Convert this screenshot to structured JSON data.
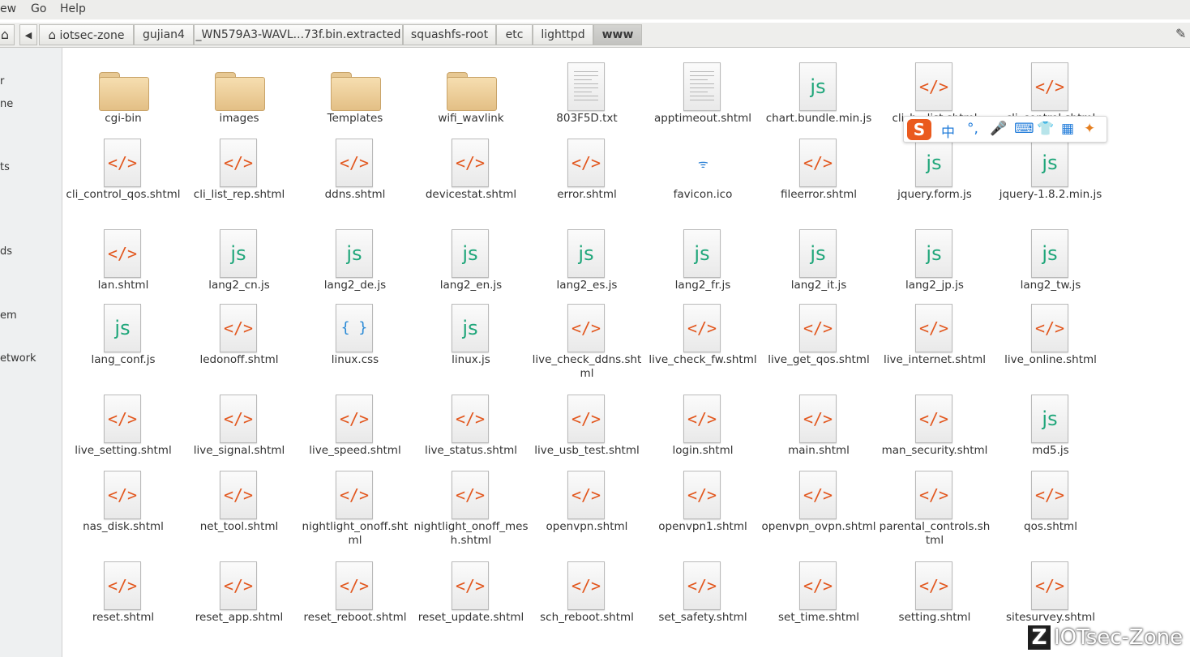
{
  "menu": {
    "view": "ew",
    "go": "Go",
    "help": "Help"
  },
  "path": {
    "crumbs": [
      "iotsec-zone",
      "gujian4",
      "_WN579A3-WAVL...73f.bin.extracted",
      "squashfs-root",
      "etc",
      "lighttpd",
      "www"
    ]
  },
  "sidebar": {
    "items": [
      "r",
      "ne",
      "ts",
      "ds",
      "em",
      "etwork"
    ]
  },
  "files": [
    {
      "name": "cgi-bin",
      "type": "folder"
    },
    {
      "name": "images",
      "type": "folder"
    },
    {
      "name": "Templates",
      "type": "folder"
    },
    {
      "name": "wifi_wavlink",
      "type": "folder"
    },
    {
      "name": "803F5D.txt",
      "type": "text"
    },
    {
      "name": "apptimeout.shtml",
      "type": "text"
    },
    {
      "name": "chart.bundle.min.js",
      "type": "js"
    },
    {
      "name": "cli_b...list.shtml",
      "type": "html"
    },
    {
      "name": "cli_control.shtml",
      "type": "html"
    },
    {
      "name": "cli_control_qos.shtml",
      "type": "html"
    },
    {
      "name": "cli_list_rep.shtml",
      "type": "html"
    },
    {
      "name": "ddns.shtml",
      "type": "html"
    },
    {
      "name": "devicestat.shtml",
      "type": "html"
    },
    {
      "name": "error.shtml",
      "type": "html"
    },
    {
      "name": "favicon.ico",
      "type": "ico"
    },
    {
      "name": "fileerror.shtml",
      "type": "html"
    },
    {
      "name": "jquery.form.js",
      "type": "js"
    },
    {
      "name": "jquery-1.8.2.min.js",
      "type": "js"
    },
    {
      "name": "lan.shtml",
      "type": "html"
    },
    {
      "name": "lang2_cn.js",
      "type": "js"
    },
    {
      "name": "lang2_de.js",
      "type": "js"
    },
    {
      "name": "lang2_en.js",
      "type": "js"
    },
    {
      "name": "lang2_es.js",
      "type": "js"
    },
    {
      "name": "lang2_fr.js",
      "type": "js"
    },
    {
      "name": "lang2_it.js",
      "type": "js"
    },
    {
      "name": "lang2_jp.js",
      "type": "js"
    },
    {
      "name": "lang2_tw.js",
      "type": "js"
    },
    {
      "name": "lang_conf.js",
      "type": "js"
    },
    {
      "name": "ledonoff.shtml",
      "type": "html"
    },
    {
      "name": "linux.css",
      "type": "css"
    },
    {
      "name": "linux.js",
      "type": "js"
    },
    {
      "name": "live_check_ddns.shtml",
      "type": "html"
    },
    {
      "name": "live_check_fw.shtml",
      "type": "html"
    },
    {
      "name": "live_get_qos.shtml",
      "type": "html"
    },
    {
      "name": "live_internet.shtml",
      "type": "html"
    },
    {
      "name": "live_online.shtml",
      "type": "html"
    },
    {
      "name": "live_setting.shtml",
      "type": "html"
    },
    {
      "name": "live_signal.shtml",
      "type": "html"
    },
    {
      "name": "live_speed.shtml",
      "type": "html"
    },
    {
      "name": "live_status.shtml",
      "type": "html"
    },
    {
      "name": "live_usb_test.shtml",
      "type": "html"
    },
    {
      "name": "login.shtml",
      "type": "html"
    },
    {
      "name": "main.shtml",
      "type": "html"
    },
    {
      "name": "man_security.shtml",
      "type": "html"
    },
    {
      "name": "md5.js",
      "type": "js"
    },
    {
      "name": "nas_disk.shtml",
      "type": "html"
    },
    {
      "name": "net_tool.shtml",
      "type": "html"
    },
    {
      "name": "nightlight_onoff.shtml",
      "type": "html"
    },
    {
      "name": "nightlight_onoff_mesh.shtml",
      "type": "html"
    },
    {
      "name": "openvpn.shtml",
      "type": "html"
    },
    {
      "name": "openvpn1.shtml",
      "type": "html"
    },
    {
      "name": "openvpn_ovpn.shtml",
      "type": "html"
    },
    {
      "name": "parental_controls.shtml",
      "type": "html"
    },
    {
      "name": "qos.shtml",
      "type": "html"
    },
    {
      "name": "reset.shtml",
      "type": "html"
    },
    {
      "name": "reset_app.shtml",
      "type": "html"
    },
    {
      "name": "reset_reboot.shtml",
      "type": "html"
    },
    {
      "name": "reset_update.shtml",
      "type": "html"
    },
    {
      "name": "sch_reboot.shtml",
      "type": "html"
    },
    {
      "name": "set_safety.shtml",
      "type": "html"
    },
    {
      "name": "set_time.shtml",
      "type": "html"
    },
    {
      "name": "setting.shtml",
      "type": "html"
    },
    {
      "name": "sitesurvey.shtml",
      "type": "html"
    }
  ],
  "ime": {
    "logo": "S",
    "lang": "中"
  },
  "watermark": {
    "text": "IOTsec-Zone",
    "mark": "Z"
  }
}
